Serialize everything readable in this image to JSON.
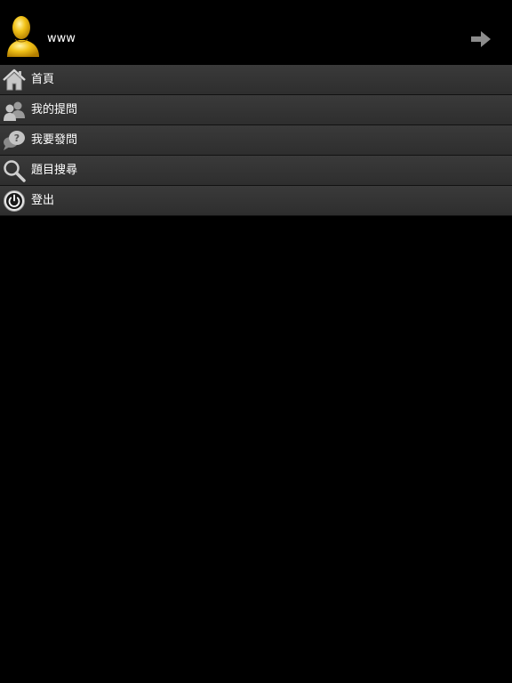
{
  "header": {
    "username": "www",
    "avatar_icon": "user-avatar-icon",
    "forward_icon": "arrow-right-icon"
  },
  "menu": {
    "items": [
      {
        "label": "首頁",
        "icon": "home-icon"
      },
      {
        "label": "我的提問",
        "icon": "users-icon"
      },
      {
        "label": "我要發問",
        "icon": "question-bubble-icon"
      },
      {
        "label": "題目搜尋",
        "icon": "search-icon"
      },
      {
        "label": "登出",
        "icon": "power-icon"
      }
    ]
  },
  "colors": {
    "background": "#000000",
    "menu_item": "#333333",
    "text": "#ffffff",
    "avatar": "#e8b400"
  }
}
